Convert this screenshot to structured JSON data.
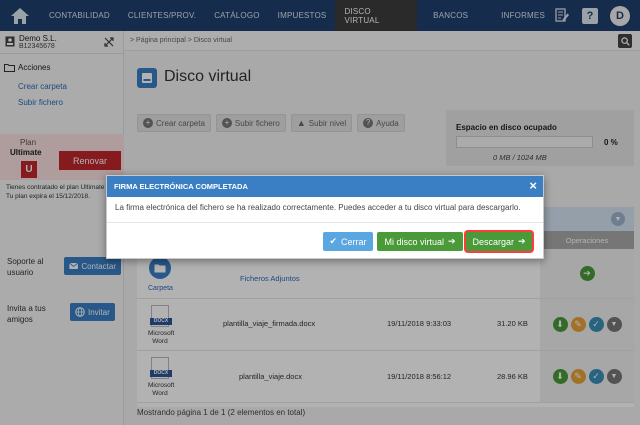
{
  "nav": {
    "items": [
      "CONTABILIDAD",
      "CLIENTES/PROV.",
      "CATÁLOGO",
      "IMPUESTOS",
      "DISCO VIRTUAL",
      "BANCOS",
      "INFORMES"
    ],
    "active": "DISCO VIRTUAL",
    "avatar": "D",
    "help": "?"
  },
  "company": {
    "name": "Demo S.L.",
    "cif": "B12345678"
  },
  "sidebar": {
    "actions_title": "Acciones",
    "links": [
      "Crear carpeta",
      "Subir fichero"
    ],
    "plan_label": "Plan",
    "plan_name": "Ultimate",
    "plan_badge": "U",
    "renew_label": "Renovar",
    "plan_info_1": "Tienes contratado el plan Ultimate",
    "plan_info_2": "Tu plan expira el 15/12/2018.",
    "support_text_1": "Soporte al",
    "support_text_2": "usuario",
    "contact_label": "Contactar",
    "invite_text_1": "Invita a tus",
    "invite_text_2": "amigos",
    "invite_label": "Invitar"
  },
  "breadcrumb": "> Página principal > Disco virtual",
  "page": {
    "title": "Disco virtual"
  },
  "toolbar": {
    "create_folder": "Crear carpeta",
    "upload_file": "Subir fichero",
    "up_level": "Subir nivel",
    "help": "Ayuda"
  },
  "space": {
    "title": "Espacio en disco ocupado",
    "percent": "0 %",
    "amount": "0 MB / 1024 MB",
    "used_fraction": 0
  },
  "table": {
    "operations_header": "Operaciones",
    "folder": {
      "type_label": "Carpeta",
      "name": "Ficheros Adjuntos"
    },
    "files": [
      {
        "badge": "DOCX",
        "type_1": "Microsoft",
        "type_2": "Word",
        "name": "plantilla_viaje_firmada.docx",
        "date": "19/11/2018 9:33:03",
        "size": "31.20 KB"
      },
      {
        "badge": "DOCX",
        "type_1": "Microsoft",
        "type_2": "Word",
        "name": "plantilla_viaje.docx",
        "date": "19/11/2018 8:56:12",
        "size": "28.96 KB"
      }
    ],
    "footer": "Mostrando página 1 de 1 (2 elementos en total)"
  },
  "modal": {
    "title": "FIRMA ELECTRÓNICA COMPLETADA",
    "close": "×",
    "message": "La firma electrónica del fichero se ha realizado correctamente. Puedes acceder a tu disco virtual para descargarlo.",
    "cancel_label": "Cerrar",
    "disk_label": "Mi disco virtual",
    "download_label": "Descargar"
  },
  "colors": {
    "nav_bg": "#1f3f6e",
    "accent_blue": "#3a7fc4",
    "green": "#4a9a3a",
    "danger": "#c0272d",
    "highlight": "#ff3b3b"
  }
}
